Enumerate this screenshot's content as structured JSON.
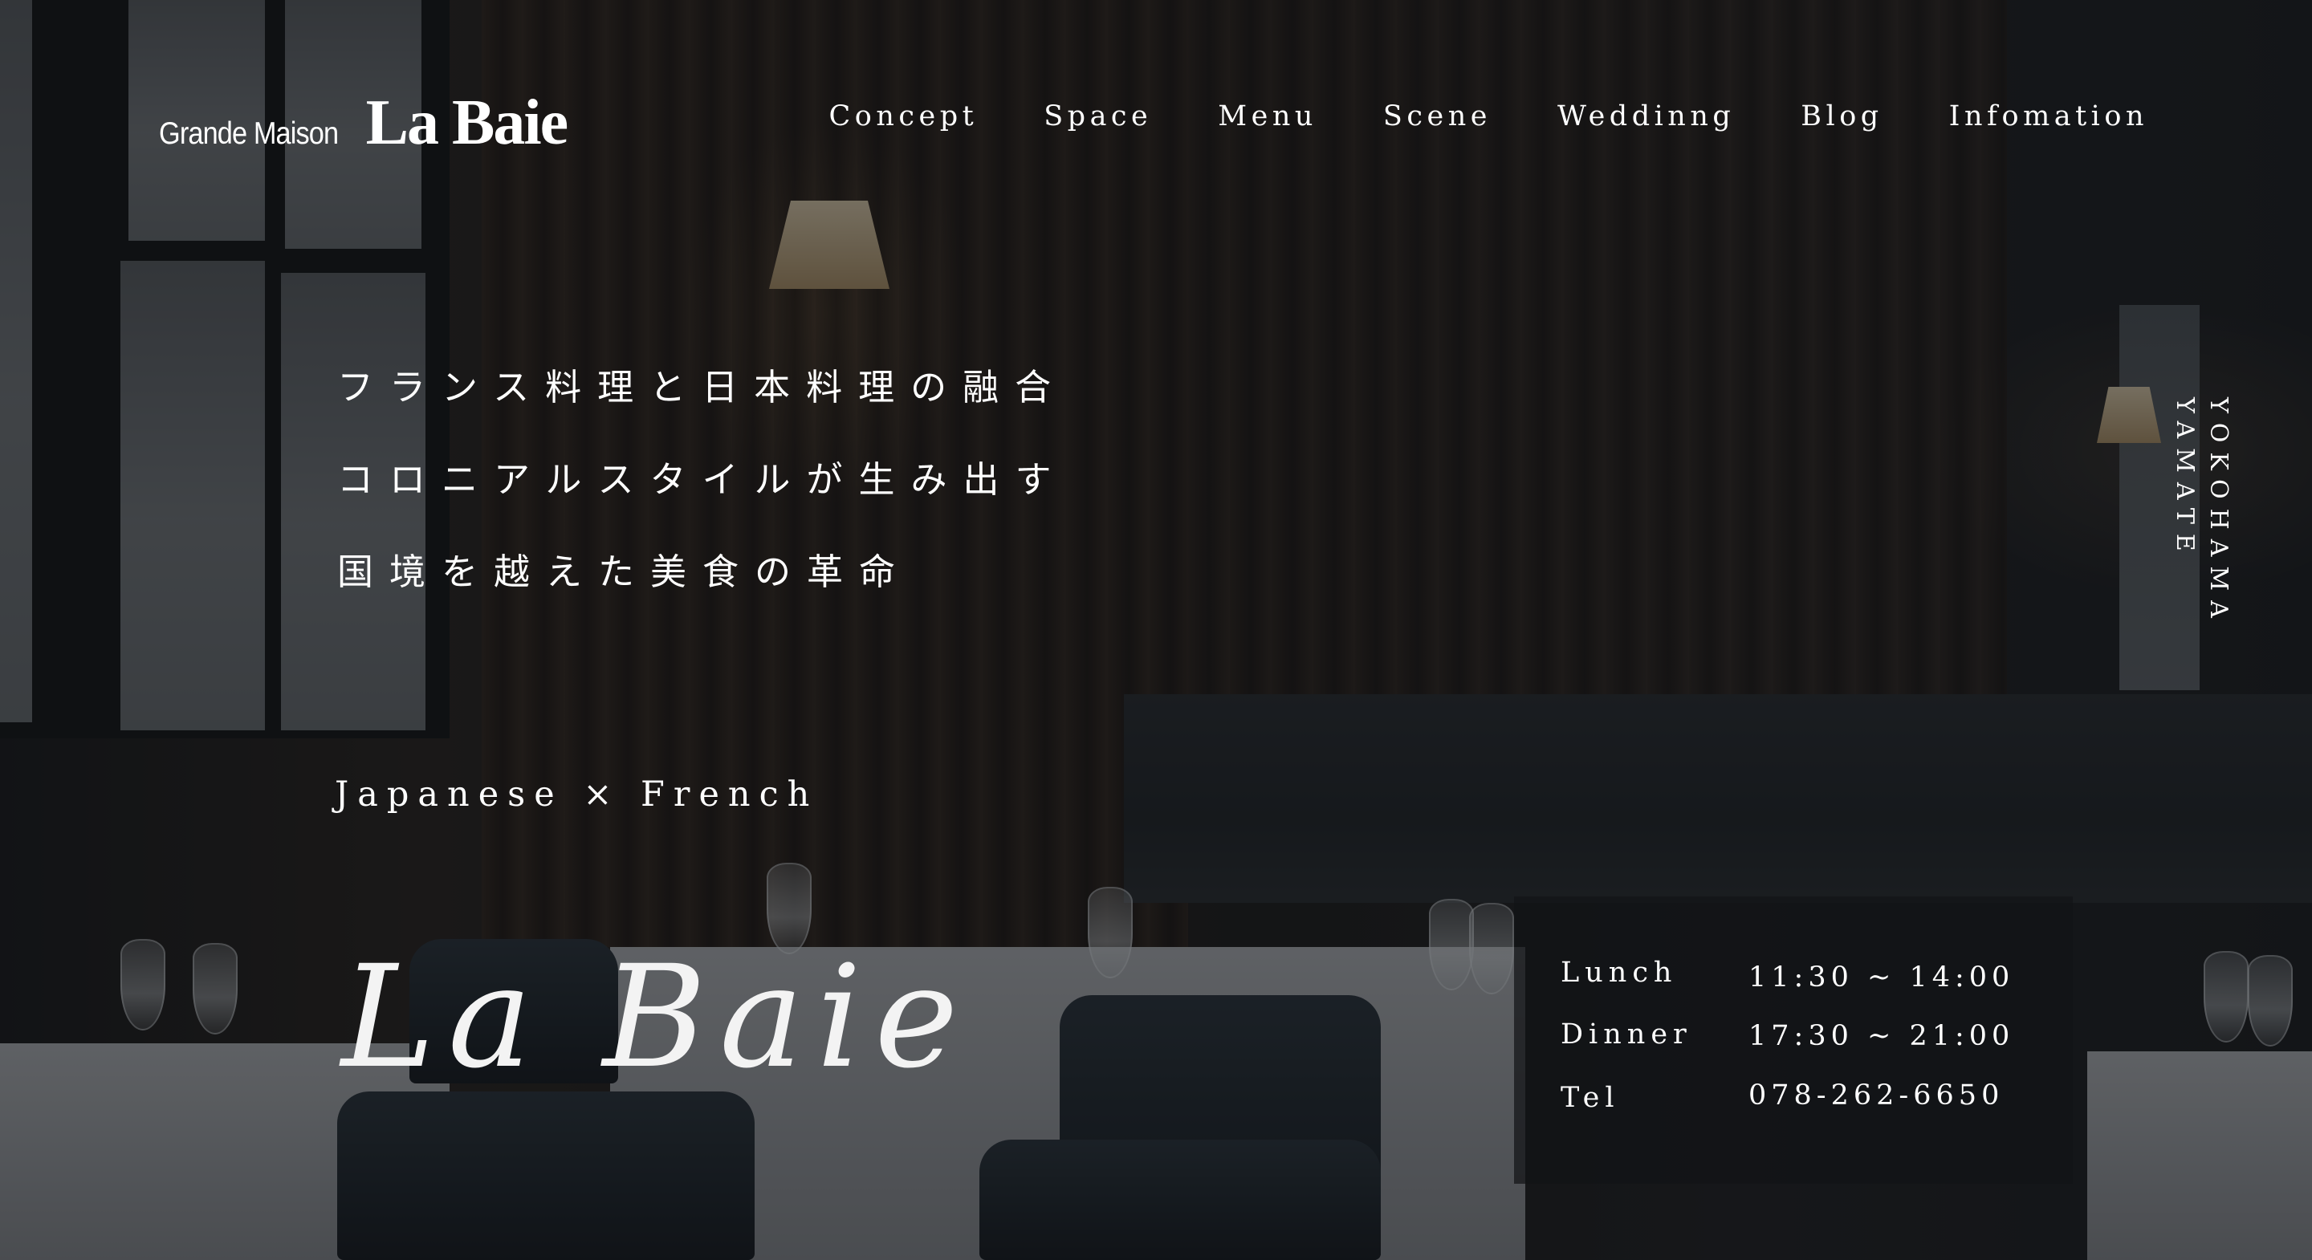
{
  "header": {
    "logo": {
      "prefix": "Grande Maison",
      "name": "La Baie"
    },
    "nav": [
      {
        "label": "Concept"
      },
      {
        "label": "Space"
      },
      {
        "label": "Menu"
      },
      {
        "label": "Scene"
      },
      {
        "label": "Weddinng"
      },
      {
        "label": "Blog"
      },
      {
        "label": "Infomation"
      }
    ]
  },
  "hero": {
    "tagline": [
      "フランス料理と日本料理の融合",
      "コロニアルスタイルが生み出す",
      "国境を越えた美食の革命"
    ],
    "subtitle": "Japanese × French",
    "brand": "La Baie",
    "location": [
      "YOKOHAMA",
      "YAMATE"
    ]
  },
  "hours": [
    {
      "label": "Lunch",
      "value": "11:30 ~ 14:00"
    },
    {
      "label": "Dinner",
      "value": "17:30 ~ 21:00"
    },
    {
      "label": "Tel",
      "value": "078-262-6650"
    }
  ],
  "colors": {
    "text": "#ffffff",
    "overlay": "#0c0d10",
    "hours_panel": "#121316"
  }
}
